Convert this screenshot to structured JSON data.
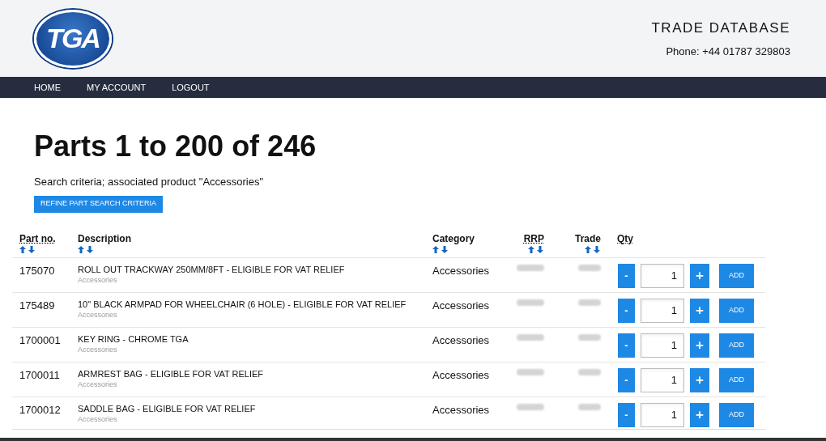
{
  "header": {
    "logo": "TGA",
    "title": "TRADE DATABASE",
    "phone": "Phone: +44 01787 329803"
  },
  "nav": [
    "HOME",
    "MY ACCOUNT",
    "LOGOUT"
  ],
  "heading": "Parts 1 to 200 of 246",
  "criteria": "Search criteria; associated product \"Accessories\"",
  "refine_button": "REFINE PART SEARCH CRITERIA",
  "table": {
    "columns": [
      {
        "label": "Part no.",
        "sortable": true,
        "abbreviated": true
      },
      {
        "label": "Description",
        "sortable": true,
        "abbreviated": false
      },
      {
        "label": "Category",
        "sortable": true,
        "abbreviated": false
      },
      {
        "label": "RRP",
        "sortable": true,
        "abbreviated": true
      },
      {
        "label": "Trade",
        "sortable": true,
        "abbreviated": false
      },
      {
        "label": "Qty",
        "sortable": false,
        "abbreviated": true
      }
    ],
    "rows": [
      {
        "part": "175070",
        "description": "ROLL OUT TRACKWAY 250MM/8FT - ELIGIBLE FOR VAT RELIEF",
        "subcategory": "Accessories",
        "category": "Accessories",
        "qty": "1",
        "minus": "-",
        "plus": "+",
        "add": "ADD"
      },
      {
        "part": "175489",
        "description": "10\" BLACK ARMPAD FOR WHEELCHAIR (6 HOLE) - ELIGIBLE FOR VAT RELIEF",
        "subcategory": "Accessories",
        "category": "Accessories",
        "qty": "1",
        "minus": "-",
        "plus": "+",
        "add": "ADD"
      },
      {
        "part": "1700001",
        "description": "KEY RING - CHROME TGA",
        "subcategory": "Accessories",
        "category": "Accessories",
        "qty": "1",
        "minus": "-",
        "plus": "+",
        "add": "ADD"
      },
      {
        "part": "1700011",
        "description": "ARMREST BAG - ELIGIBLE FOR VAT RELIEF",
        "subcategory": "Accessories",
        "category": "Accessories",
        "qty": "1",
        "minus": "-",
        "plus": "+",
        "add": "ADD"
      },
      {
        "part": "1700012",
        "description": "SADDLE BAG - ELIGIBLE FOR VAT RELIEF",
        "subcategory": "Accessories",
        "category": "Accessories",
        "qty": "1",
        "minus": "-",
        "plus": "+",
        "add": "ADD"
      }
    ]
  }
}
